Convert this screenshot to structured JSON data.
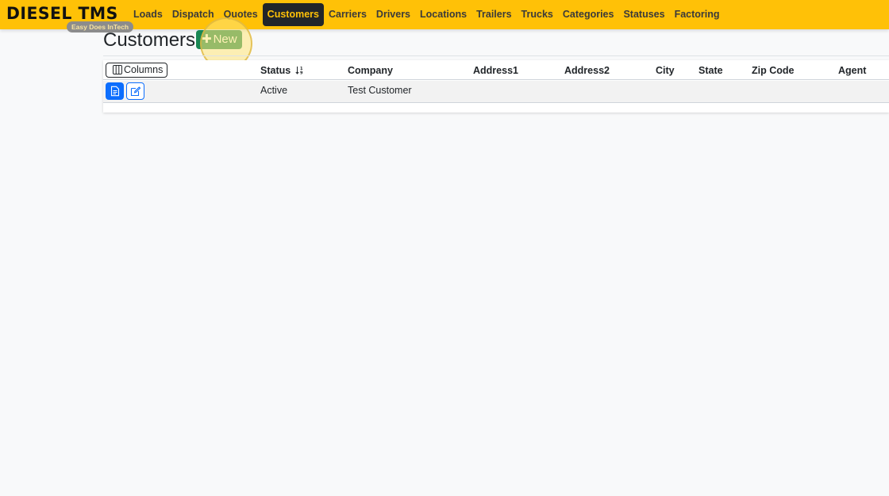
{
  "brand": {
    "name": "DIESEL TMS",
    "tagline": "Easy Does InTech"
  },
  "nav": {
    "items": [
      {
        "label": "Loads",
        "active": false
      },
      {
        "label": "Dispatch",
        "active": false
      },
      {
        "label": "Quotes",
        "active": false
      },
      {
        "label": "Customers",
        "active": true
      },
      {
        "label": "Carriers",
        "active": false
      },
      {
        "label": "Drivers",
        "active": false
      },
      {
        "label": "Locations",
        "active": false
      },
      {
        "label": "Trailers",
        "active": false
      },
      {
        "label": "Trucks",
        "active": false
      },
      {
        "label": "Categories",
        "active": false
      },
      {
        "label": "Statuses",
        "active": false
      },
      {
        "label": "Factoring",
        "active": false
      }
    ]
  },
  "page": {
    "title": "Customers",
    "new_label": "New",
    "new_icon": "plus-icon"
  },
  "table": {
    "columns_button": "Columns",
    "columns_icon": "columns-icon",
    "headers": {
      "status": "Status",
      "company": "Company",
      "address1": "Address1",
      "address2": "Address2",
      "city": "City",
      "state": "State",
      "zip": "Zip Code",
      "agent": "Agent"
    },
    "sort_icon": "sort-icon",
    "rows": [
      {
        "status": "Active",
        "company": "Test Customer",
        "address1": "",
        "address2": "",
        "city": "",
        "state": "",
        "zip": "",
        "agent": "",
        "view_icon": "document-icon",
        "edit_icon": "edit-icon"
      }
    ]
  },
  "colors": {
    "navbar": "#ffc107",
    "active_nav_bg": "#212529",
    "new_button": "#198754",
    "primary": "#0d6efd",
    "page_bg": "#f8f9fa"
  }
}
